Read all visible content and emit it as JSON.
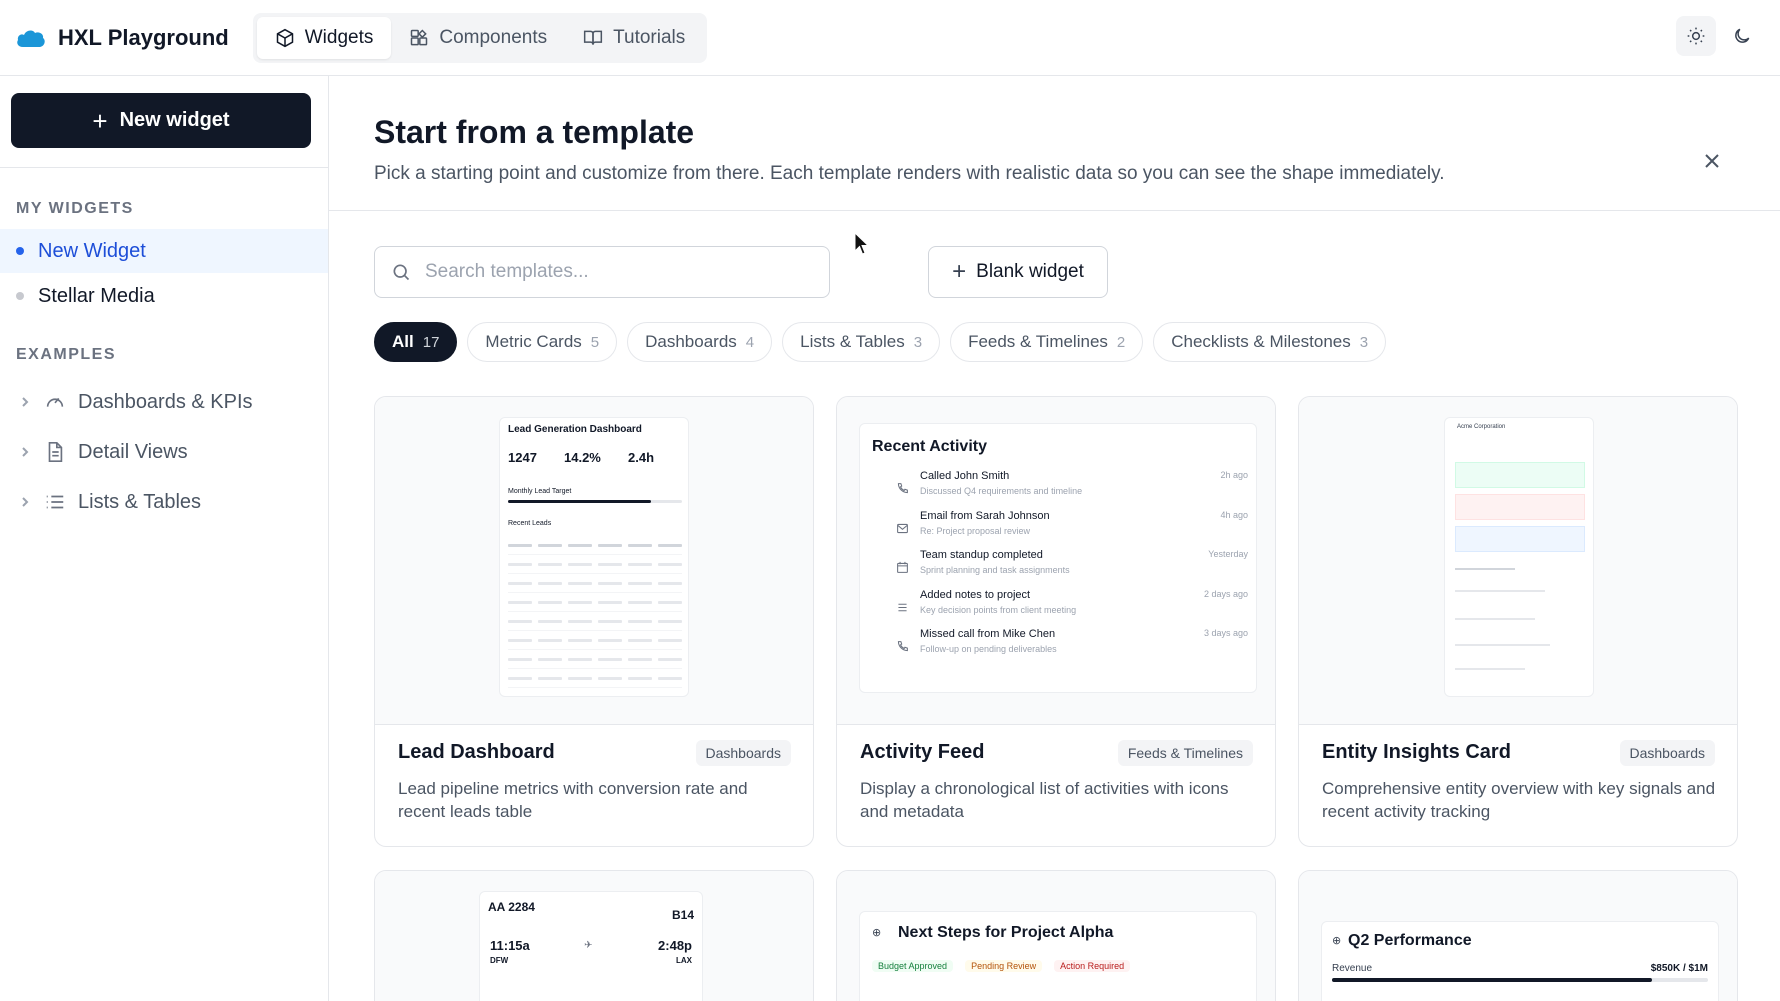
{
  "app": {
    "title": "HXL Playground"
  },
  "nav": {
    "tabs": [
      {
        "label": "Widgets",
        "icon": "cube-icon",
        "active": true
      },
      {
        "label": "Components",
        "icon": "components-icon",
        "active": false
      },
      {
        "label": "Tutorials",
        "icon": "book-icon",
        "active": false
      }
    ],
    "theme": {
      "light_icon": "sun-icon",
      "dark_icon": "moon-icon",
      "active": "light"
    }
  },
  "sidebar": {
    "new_widget_label": "New widget",
    "my_widgets_heading": "MY WIDGETS",
    "my_widgets": [
      {
        "label": "New Widget",
        "active": true
      },
      {
        "label": "Stellar Media",
        "active": false
      }
    ],
    "examples_heading": "EXAMPLES",
    "examples": [
      {
        "label": "Dashboards & KPIs",
        "icon": "gauge-icon"
      },
      {
        "label": "Detail Views",
        "icon": "document-icon"
      },
      {
        "label": "Lists & Tables",
        "icon": "list-icon"
      }
    ]
  },
  "main": {
    "title": "Start from a template",
    "subtitle": "Pick a starting point and customize from there. Each template renders with realistic data so you can see the shape immediately.",
    "search_placeholder": "Search templates...",
    "blank_widget_label": "Blank widget",
    "filters": [
      {
        "label": "All",
        "count": "17",
        "active": true
      },
      {
        "label": "Metric Cards",
        "count": "5",
        "active": false
      },
      {
        "label": "Dashboards",
        "count": "4",
        "active": false
      },
      {
        "label": "Lists & Tables",
        "count": "3",
        "active": false
      },
      {
        "label": "Feeds & Timelines",
        "count": "2",
        "active": false
      },
      {
        "label": "Checklists & Milestones",
        "count": "3",
        "active": false
      }
    ],
    "cards": [
      {
        "name": "Lead Dashboard",
        "tag": "Dashboards",
        "description": "Lead pipeline metrics with conversion rate and recent leads table"
      },
      {
        "name": "Activity Feed",
        "tag": "Feeds & Timelines",
        "description": "Display a chronological list of activities with icons and metadata"
      },
      {
        "name": "Entity Insights Card",
        "tag": "Dashboards",
        "description": "Comprehensive entity overview with key signals and recent activity tracking"
      }
    ]
  },
  "previews": {
    "lead": {
      "title": "Lead Generation Dashboard",
      "metrics": [
        {
          "value": "1247"
        },
        {
          "value": "14.2%"
        },
        {
          "value": "2.4h"
        }
      ],
      "target_label": "Monthly Lead Target",
      "recent_label": "Recent Leads",
      "progress": 0.82
    },
    "activity": {
      "title": "Recent Activity",
      "items": [
        {
          "icon": "phone-icon",
          "title": "Called John Smith",
          "sub": "Discussed Q4 requirements and timeline",
          "time": "2h ago"
        },
        {
          "icon": "mail-icon",
          "title": "Email from Sarah Johnson",
          "sub": "Re: Project proposal review",
          "time": "4h ago"
        },
        {
          "icon": "calendar-icon",
          "title": "Team standup completed",
          "sub": "Sprint planning and task assignments",
          "time": "Yesterday"
        },
        {
          "icon": "notes-icon",
          "title": "Added notes to project",
          "sub": "Key decision points from client meeting",
          "time": "2 days ago"
        },
        {
          "icon": "phone-icon",
          "title": "Missed call from Mike Chen",
          "sub": "Follow-up on pending deliverables",
          "time": "3 days ago"
        }
      ]
    },
    "entity": {
      "title": "Acme Corporation"
    },
    "flight": {
      "flight": "AA 2284",
      "gate": "B14",
      "depart_time": "11:15a",
      "depart_code": "DFW",
      "arrive_time": "2:48p",
      "arrive_code": "LAX"
    },
    "steps": {
      "title": "Next Steps for Project Alpha",
      "badges": [
        "Budget Approved",
        "Pending Review",
        "Action Required"
      ]
    },
    "perf": {
      "title": "Q2 Performance",
      "revenue_label": "Revenue",
      "revenue_value": "$850K / $1M",
      "revenue_progress": 0.85
    }
  },
  "colors": {
    "primary_dark": "#111827",
    "accent_blue": "#2563eb",
    "border": "#e5e7eb"
  }
}
